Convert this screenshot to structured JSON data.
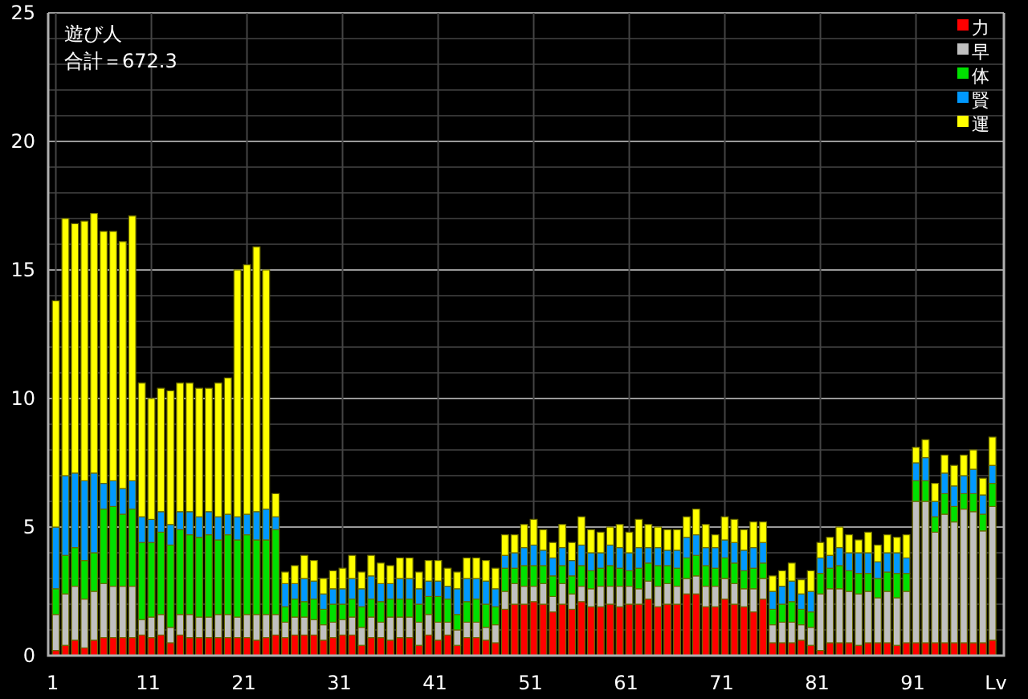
{
  "chart": {
    "heading": "遊び人",
    "total": "合計＝672.3",
    "chart_data": {
      "type": "bar",
      "stacked": true,
      "grid": true,
      "legend": true,
      "xlabel": "Lv",
      "xlim": [
        0.2,
        100.2
      ],
      "ylim": [
        0,
        25
      ],
      "yticks": [
        0,
        5,
        10,
        15,
        20,
        25
      ],
      "xticks": [
        {
          "value": 1,
          "label": "1"
        },
        {
          "value": 11,
          "label": "11"
        },
        {
          "value": 21,
          "label": "21"
        },
        {
          "value": 31,
          "label": "31"
        },
        {
          "value": 41,
          "label": "41"
        },
        {
          "value": 51,
          "label": "51"
        },
        {
          "value": 61,
          "label": "61"
        },
        {
          "value": 71,
          "label": "71"
        },
        {
          "value": 81,
          "label": "81"
        },
        {
          "value": 91,
          "label": "91"
        }
      ],
      "x": [
        1,
        2,
        3,
        4,
        5,
        6,
        7,
        8,
        9,
        10,
        11,
        12,
        13,
        14,
        15,
        16,
        17,
        18,
        19,
        20,
        21,
        22,
        23,
        24,
        25,
        26,
        27,
        28,
        29,
        30,
        31,
        32,
        33,
        34,
        35,
        36,
        37,
        38,
        39,
        40,
        41,
        42,
        43,
        44,
        45,
        46,
        47,
        48,
        49,
        50,
        51,
        52,
        53,
        54,
        55,
        56,
        57,
        58,
        59,
        60,
        61,
        62,
        63,
        64,
        65,
        66,
        67,
        68,
        69,
        70,
        71,
        72,
        73,
        74,
        75,
        76,
        77,
        78,
        79,
        80,
        81,
        82,
        83,
        84,
        85,
        86,
        87,
        88,
        89,
        90,
        91,
        92,
        93,
        94,
        95,
        96,
        97,
        98,
        99
      ],
      "series": [
        {
          "name": "力",
          "color": "#ff0000",
          "values": [
            0.2,
            0.4,
            0.6,
            0.3,
            0.6,
            0.7,
            0.7,
            0.7,
            0.7,
            0.8,
            0.7,
            0.8,
            0.5,
            0.8,
            0.7,
            0.7,
            0.7,
            0.7,
            0.7,
            0.7,
            0.7,
            0.6,
            0.7,
            0.8,
            0.7,
            0.8,
            0.8,
            0.8,
            0.6,
            0.7,
            0.8,
            0.8,
            0.4,
            0.7,
            0.7,
            0.6,
            0.7,
            0.7,
            0.4,
            0.8,
            0.6,
            0.8,
            0.4,
            0.7,
            0.7,
            0.6,
            0.5,
            1.8,
            2.0,
            2.0,
            2.1,
            2.0,
            1.7,
            2.0,
            1.8,
            2.1,
            1.9,
            1.9,
            2.0,
            1.9,
            2.0,
            2.0,
            2.2,
            1.9,
            2.0,
            2.0,
            2.4,
            2.4,
            1.9,
            1.9,
            2.2,
            2.0,
            1.9,
            1.7,
            2.2,
            0.5,
            0.5,
            0.5,
            0.6,
            0.4,
            0.2,
            0.5,
            0.5,
            0.5,
            0.4,
            0.5,
            0.5,
            0.5,
            0.4,
            0.5,
            0.5,
            0.5,
            0.5,
            0.5,
            0.5,
            0.5,
            0.5,
            0.5,
            0.6
          ]
        },
        {
          "name": "早",
          "color": "#c0c0c0",
          "values": [
            1.4,
            2.0,
            2.1,
            1.9,
            1.9,
            2.1,
            2.0,
            2.0,
            2.0,
            0.6,
            0.8,
            0.8,
            0.6,
            0.8,
            0.9,
            0.8,
            0.8,
            0.9,
            0.9,
            0.8,
            0.9,
            1.0,
            0.9,
            0.8,
            0.6,
            0.7,
            0.7,
            0.6,
            0.6,
            0.6,
            0.6,
            0.7,
            0.7,
            0.8,
            0.6,
            0.9,
            0.8,
            0.8,
            0.9,
            0.8,
            0.7,
            0.5,
            0.6,
            0.6,
            0.6,
            0.5,
            0.7,
            0.7,
            0.8,
            0.7,
            0.6,
            0.8,
            0.6,
            0.8,
            0.6,
            0.6,
            0.7,
            0.8,
            0.7,
            0.8,
            0.7,
            0.6,
            0.7,
            0.8,
            0.8,
            0.7,
            0.6,
            0.7,
            0.8,
            0.8,
            0.8,
            0.8,
            0.7,
            0.9,
            0.8,
            0.7,
            0.8,
            0.8,
            0.6,
            0.7,
            2.2,
            2.1,
            2.1,
            2.0,
            2.0,
            2.0,
            1.75,
            2.0,
            1.85,
            2.0,
            5.5,
            5.5,
            4.3,
            5.0,
            4.7,
            5.2,
            5.1,
            4.35,
            5.2
          ]
        },
        {
          "name": "体",
          "color": "#00e000",
          "values": [
            1.0,
            1.5,
            1.5,
            1.5,
            1.5,
            2.9,
            3.1,
            2.8,
            3.0,
            3.0,
            2.9,
            3.2,
            3.2,
            3.3,
            3.1,
            3.1,
            3.2,
            2.9,
            3.1,
            3.0,
            3.1,
            2.9,
            2.9,
            3.3,
            0.6,
            0.7,
            0.6,
            0.8,
            0.6,
            0.7,
            0.6,
            0.7,
            0.8,
            0.7,
            0.8,
            0.7,
            0.7,
            0.7,
            0.7,
            0.7,
            1.0,
            0.9,
            0.6,
            0.8,
            0.9,
            0.9,
            0.7,
            0.9,
            0.6,
            0.8,
            0.8,
            0.7,
            0.8,
            0.7,
            0.7,
            0.8,
            0.7,
            0.7,
            0.8,
            0.7,
            0.6,
            0.8,
            0.7,
            0.8,
            0.7,
            0.7,
            0.8,
            0.8,
            0.8,
            0.7,
            0.8,
            0.8,
            0.7,
            0.8,
            0.6,
            0.6,
            0.7,
            0.8,
            0.6,
            0.6,
            0.8,
            0.8,
            0.9,
            0.8,
            0.8,
            0.7,
            0.75,
            0.75,
            0.95,
            0.7,
            0.8,
            0.8,
            0.6,
            0.8,
            0.6,
            0.6,
            0.7,
            0.65,
            0.9
          ]
        },
        {
          "name": "賢",
          "color": "#0099ff",
          "values": [
            2.4,
            3.1,
            2.9,
            3.1,
            3.1,
            1.0,
            1.0,
            1.0,
            1.1,
            1.0,
            0.9,
            0.8,
            0.8,
            0.7,
            0.9,
            0.8,
            0.9,
            0.9,
            0.8,
            0.9,
            0.8,
            1.1,
            1.2,
            0.5,
            0.9,
            0.6,
            0.9,
            0.7,
            0.6,
            0.6,
            0.6,
            0.8,
            0.7,
            0.9,
            0.7,
            0.6,
            0.8,
            0.8,
            0.6,
            0.6,
            0.6,
            0.5,
            1.0,
            0.9,
            0.8,
            0.9,
            0.7,
            0.5,
            0.6,
            0.7,
            0.8,
            0.6,
            0.7,
            0.7,
            0.6,
            0.8,
            0.7,
            0.6,
            0.8,
            0.8,
            0.7,
            0.8,
            0.6,
            0.7,
            0.6,
            0.7,
            0.8,
            0.8,
            0.7,
            0.8,
            0.7,
            0.8,
            0.8,
            0.8,
            0.8,
            0.7,
            0.7,
            0.8,
            0.6,
            0.8,
            0.6,
            0.5,
            0.7,
            0.7,
            0.8,
            0.8,
            0.65,
            0.75,
            0.8,
            0.6,
            0.7,
            0.9,
            0.6,
            0.8,
            0.8,
            0.7,
            0.95,
            0.75,
            0.7
          ]
        },
        {
          "name": "運",
          "color": "#ffff00",
          "values": [
            8.8,
            10.0,
            9.7,
            10.1,
            10.1,
            9.8,
            9.7,
            9.6,
            10.3,
            5.2,
            4.7,
            4.8,
            5.2,
            5.0,
            5.0,
            5.0,
            4.8,
            5.2,
            5.3,
            9.6,
            9.7,
            10.3,
            9.3,
            0.9,
            0.45,
            0.7,
            0.9,
            0.8,
            0.6,
            0.7,
            0.8,
            0.9,
            0.65,
            0.8,
            0.8,
            0.7,
            0.8,
            0.8,
            0.65,
            0.8,
            0.8,
            0.7,
            0.65,
            0.8,
            0.8,
            0.8,
            0.8,
            0.8,
            0.7,
            0.9,
            1.0,
            0.8,
            0.6,
            0.9,
            0.7,
            1.1,
            0.9,
            0.8,
            0.7,
            0.9,
            0.8,
            1.1,
            0.9,
            0.8,
            0.8,
            0.8,
            0.8,
            1.0,
            0.9,
            0.5,
            0.9,
            0.9,
            0.8,
            1.0,
            0.8,
            0.6,
            0.6,
            0.7,
            0.55,
            0.8,
            0.6,
            0.7,
            0.8,
            0.7,
            0.5,
            0.8,
            0.65,
            0.7,
            0.6,
            0.9,
            0.6,
            0.7,
            0.7,
            0.7,
            0.8,
            0.8,
            0.75,
            0.65,
            1.1
          ]
        }
      ]
    }
  }
}
